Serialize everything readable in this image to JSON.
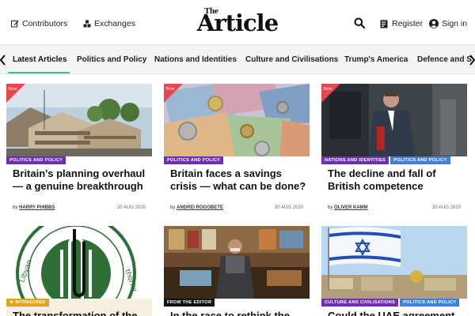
{
  "header": {
    "contributors_label": "Contributors",
    "exchanges_label": "Exchanges",
    "logo_small": "The",
    "logo_main": "Article",
    "register_label": "Register",
    "signin_label": "Sign in"
  },
  "nav": {
    "items": [
      {
        "label": "Latest Articles"
      },
      {
        "label": "Politics and Policy"
      },
      {
        "label": "Nations and Identities"
      },
      {
        "label": "Culture and Civilisations"
      },
      {
        "label": "Trump's America"
      },
      {
        "label": "Defence and S"
      }
    ]
  },
  "new_label": "New",
  "cards": [
    {
      "tags": [
        "POLITICS AND POLICY"
      ],
      "title": "Britain's planning overhaul — a genuine breakthrough",
      "by": "by",
      "author": "HARRY PHIBBS",
      "date": "20 AUG 2020"
    },
    {
      "tags": [
        "POLITICS AND POLICY"
      ],
      "title": "Britain faces a savings crisis — what can be done?",
      "by": "by",
      "author": "ANDREI ROGOBETE",
      "date": "20 AUG 2020"
    },
    {
      "tags": [
        "NATIONS AND IDENTITIES",
        "POLITICS AND POLICY"
      ],
      "title": "The decline and fall of British competence",
      "by": "by",
      "author": "OLIVER KAMM",
      "date": "20 AUG 2020"
    },
    {
      "tags": [
        "SPONSORED"
      ],
      "title": "The transformation of the",
      "by": "",
      "author": "",
      "date": ""
    },
    {
      "tags": [
        "FROM THE EDITOR"
      ],
      "title": "In the race to rethink the",
      "by": "",
      "author": "",
      "date": ""
    },
    {
      "tags": [
        "CULTURE AND CIVILISATIONS",
        "POLITICS AND POLICY"
      ],
      "title": "Could the UAE agreement",
      "by": "",
      "author": "",
      "date": ""
    }
  ],
  "colors": {
    "accent_green": "#2fc58a",
    "tag_purple": "#6f2fb4",
    "tag_blue": "#3e7fe0",
    "new_red": "#e8474f",
    "sponsored_gold": "#e2a514"
  },
  "icons": {
    "contributors": "edit-icon",
    "exchanges": "exchanges-icon",
    "search": "search-icon",
    "register": "register-icon",
    "signin": "user-circle-icon"
  }
}
